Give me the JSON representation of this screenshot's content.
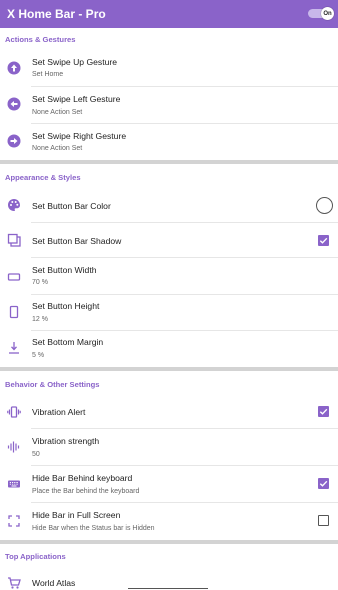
{
  "app": {
    "title": "X Home Bar - Pro",
    "toggle_label": "On",
    "colors": {
      "accent": "#8a63c9",
      "divider": "#d3d3d3"
    }
  },
  "sections": {
    "actions": {
      "header": "Actions & Gestures",
      "items": [
        {
          "title": "Set Swipe Up Gesture",
          "subtitle": "Set Home",
          "icon": "arrow-up-circle-icon"
        },
        {
          "title": "Set Swipe Left Gesture",
          "subtitle": "None Action Set",
          "icon": "arrow-left-circle-icon"
        },
        {
          "title": "Set Swipe Right Gesture",
          "subtitle": "None Action Set",
          "icon": "arrow-right-circle-icon"
        }
      ]
    },
    "appearance": {
      "header": "Appearance & Styles",
      "items": [
        {
          "title": "Set Button Bar Color",
          "icon": "palette-icon",
          "control": "color-radio"
        },
        {
          "title": "Set Button Bar Shadow",
          "icon": "shadow-icon",
          "control": "checkbox",
          "checked": true
        },
        {
          "title": "Set Button Width",
          "subtitle": "70 %",
          "icon": "width-icon"
        },
        {
          "title": "Set Button Height",
          "subtitle": "12 %",
          "icon": "height-icon"
        },
        {
          "title": "Set Bottom Margin",
          "subtitle": "5 %",
          "icon": "bottom-margin-icon"
        }
      ]
    },
    "behavior": {
      "header": "Behavior & Other Settings",
      "items": [
        {
          "title": "Vibration Alert",
          "icon": "vibration-icon",
          "control": "checkbox",
          "checked": true
        },
        {
          "title": "Vibration strength",
          "subtitle": "50",
          "icon": "vibration-strength-icon"
        },
        {
          "title": "Hide Bar Behind keyboard",
          "subtitle": "Place the Bar behind the keyboard",
          "icon": "keyboard-icon",
          "control": "checkbox",
          "checked": true
        },
        {
          "title": "Hide Bar in Full Screen",
          "subtitle": "Hide Bar when the Status bar is Hidden",
          "icon": "fullscreen-icon",
          "control": "checkbox",
          "checked": false
        }
      ]
    },
    "top_apps": {
      "header": "Top Applications",
      "items": [
        {
          "title": "World Atlas",
          "icon": "cart-icon"
        }
      ]
    }
  }
}
